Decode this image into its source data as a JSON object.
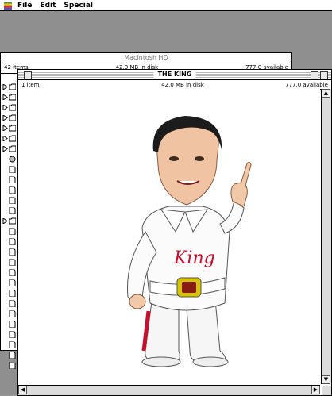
{
  "menubar": {
    "items": [
      "File",
      "Edit",
      "Special"
    ]
  },
  "back_window": {
    "title": "Macintosh HD",
    "items_count": "42 items",
    "disk": "42.0 MB in disk",
    "available": "777.0 available"
  },
  "front_window": {
    "title": "THE KING",
    "items_count": "1 item",
    "disk": "42.0 MB in disk",
    "available": "777.0 available"
  },
  "image": {
    "belt_text": "King"
  },
  "colors": {
    "desktop": "#8f8f8f",
    "window": "#ffffff",
    "accent_red": "#c8102e",
    "buckle": "#d8c300"
  }
}
